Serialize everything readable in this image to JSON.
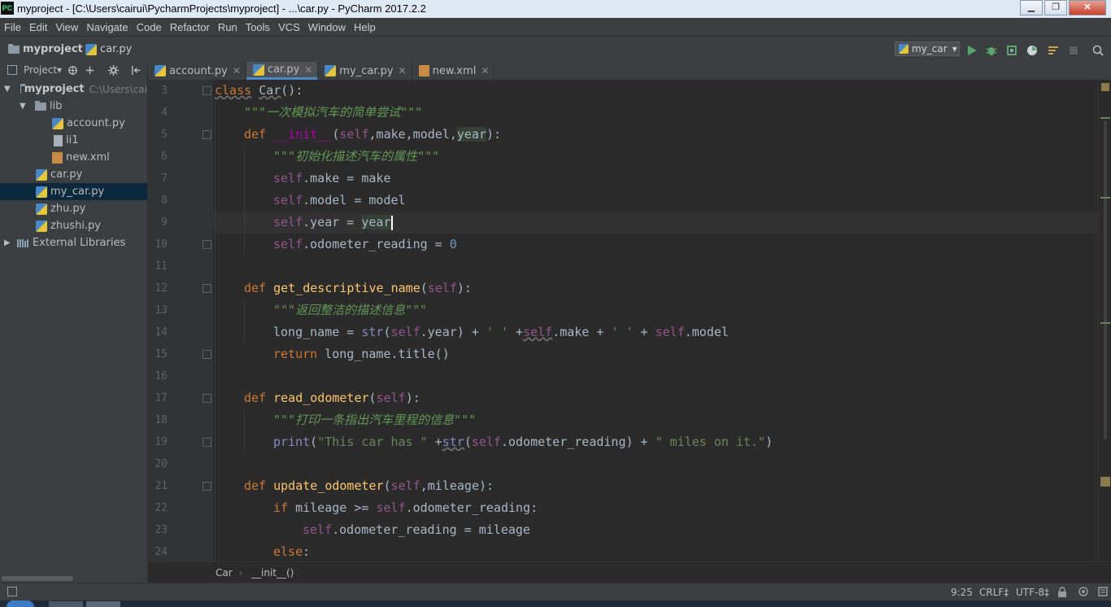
{
  "window": {
    "title": "myproject - [C:\\Users\\cairui\\PycharmProjects\\myproject] - ...\\car.py - PyCharm 2017.2.2",
    "logo": "PC",
    "minimize": "▁",
    "maximize": "❐",
    "close": "✕"
  },
  "menu": [
    "File",
    "Edit",
    "View",
    "Navigate",
    "Code",
    "Refactor",
    "Run",
    "Tools",
    "VCS",
    "Window",
    "Help"
  ],
  "nav": {
    "project": "myproject",
    "file": "car.py",
    "run_config": "my_car",
    "run_config_arrow": "▾"
  },
  "project_panel": {
    "title": "Project▾",
    "tree": [
      {
        "label": "myproject",
        "extra": "C:\\Users\\cai",
        "type": "folder",
        "arrow": "▼"
      },
      {
        "label": "lib",
        "type": "folder",
        "arrow": "▼"
      },
      {
        "label": "account.py",
        "type": "py"
      },
      {
        "label": "li1",
        "type": "file"
      },
      {
        "label": "new.xml",
        "type": "xml"
      },
      {
        "label": "car.py",
        "type": "py"
      },
      {
        "label": "my_car.py",
        "type": "py"
      },
      {
        "label": "zhu.py",
        "type": "py"
      },
      {
        "label": "zhushi.py",
        "type": "py"
      },
      {
        "label": "External Libraries",
        "type": "lib",
        "arrow": "▶"
      }
    ]
  },
  "tabs": [
    {
      "label": "account.py",
      "close": "✕"
    },
    {
      "label": "car.py",
      "close": "✕"
    },
    {
      "label": "my_car.py",
      "close": "✕"
    },
    {
      "label": "new.xml",
      "close": "✕"
    }
  ],
  "line_numbers": [
    "3",
    "4",
    "5",
    "6",
    "7",
    "8",
    "9",
    "10",
    "11",
    "12",
    "13",
    "14",
    "15",
    "16",
    "17",
    "18",
    "19",
    "20",
    "21",
    "22",
    "23",
    "24"
  ],
  "code": {
    "l3": {
      "kw": "class",
      "name": "Car",
      "rest": "():"
    },
    "l4": "\"\"\"一次模拟汽车的简单尝试\"\"\"",
    "l5": {
      "kw": "def",
      "fn": "__init__",
      "p1": "(",
      "self": "self",
      "args": ",make,model,",
      "year": "year",
      "end": "):"
    },
    "l6": "\"\"\"初始化描述汽车的属性\"\"\"",
    "l7": {
      "self": "self",
      "rest": ".make = make"
    },
    "l8": {
      "self": "self",
      "rest": ".model = model"
    },
    "l9": {
      "self": "self",
      "rest": ".year = ",
      "val": "year"
    },
    "l10": {
      "self": "self",
      "rest": ".odometer_reading = ",
      "num": "0"
    },
    "l12": {
      "kw": "def",
      "fn": "get_descriptive_name",
      "p1": "(",
      "self": "self",
      "end": "):"
    },
    "l13": "\"\"\"返回整洁的描述信息\"\"\"",
    "l14": {
      "a": "long_name = ",
      "str": "str",
      "b": "(",
      "self1": "self",
      "c": ".year) + ",
      "s1": "' '",
      "d": " +",
      "self2": "self",
      "e": ".make + ",
      "s2": "' '",
      "f": " + ",
      "self3": "self",
      "g": ".model"
    },
    "l15": {
      "kw": "return",
      "rest": " long_name.title()"
    },
    "l17": {
      "kw": "def",
      "fn": "read_odometer",
      "p1": "(",
      "self": "self",
      "end": "):"
    },
    "l18": "\"\"\"打印一条指出汽车里程的信息\"\"\"",
    "l19": {
      "print": "print",
      "a": "(",
      "s1": "\"This car has \"",
      "b": " +",
      "str": "str",
      "c": "(",
      "self": "self",
      "d": ".odometer_reading) + ",
      "s2": "\" miles on it.\"",
      "e": ")"
    },
    "l21": {
      "kw": "def",
      "fn": "update_odometer",
      "p1": "(",
      "self": "self",
      "args": ",mileage):"
    },
    "l22": {
      "kw": "if",
      "a": " mileage >= ",
      "self": "self",
      "b": ".odometer_reading:"
    },
    "l23": {
      "self": "self",
      "rest": ".odometer_reading = mileage"
    },
    "l24": {
      "kw": "else",
      "rest": ":"
    }
  },
  "breadcrumb": {
    "cls": "Car",
    "sep": "›",
    "method": "__init__()"
  },
  "status": {
    "position": "9:25",
    "line_sep": "CRLF‡",
    "encoding": "UTF-8‡"
  },
  "colors": {
    "accent": "#4a88c7",
    "keyword": "#cc7832",
    "self": "#94558d",
    "docstring": "#629755",
    "number": "#6897bb"
  }
}
